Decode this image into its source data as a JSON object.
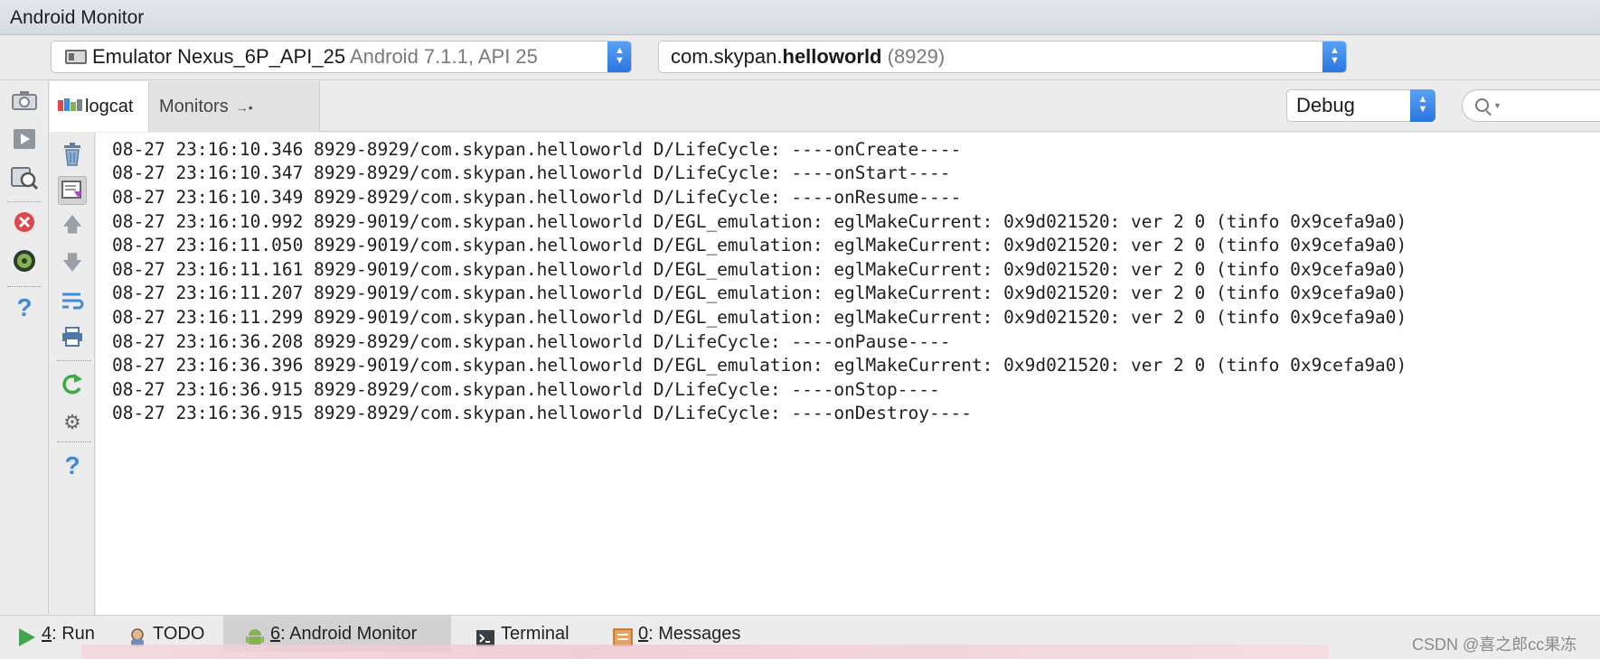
{
  "window": {
    "title": "Android Monitor"
  },
  "device_bar": {
    "device_name": "Emulator Nexus_6P_API_25",
    "device_version": "Android 7.1.1, API 25",
    "process_prefix": "com.skypan.",
    "process_name": "helloworld",
    "process_pid": "(8929)"
  },
  "tabs": {
    "logcat": "logcat",
    "monitors": "Monitors",
    "monitors_pin": "→•"
  },
  "log_level": {
    "selected": "Debug"
  },
  "search": {
    "placeholder": ""
  },
  "log_lines": [
    "08-27 23:16:10.346 8929-8929/com.skypan.helloworld D/LifeCycle: ----onCreate----",
    "08-27 23:16:10.347 8929-8929/com.skypan.helloworld D/LifeCycle: ----onStart----",
    "08-27 23:16:10.349 8929-8929/com.skypan.helloworld D/LifeCycle: ----onResume----",
    "08-27 23:16:10.992 8929-9019/com.skypan.helloworld D/EGL_emulation: eglMakeCurrent: 0x9d021520: ver 2 0 (tinfo 0x9cefa9a0)",
    "08-27 23:16:11.050 8929-9019/com.skypan.helloworld D/EGL_emulation: eglMakeCurrent: 0x9d021520: ver 2 0 (tinfo 0x9cefa9a0)",
    "08-27 23:16:11.161 8929-9019/com.skypan.helloworld D/EGL_emulation: eglMakeCurrent: 0x9d021520: ver 2 0 (tinfo 0x9cefa9a0)",
    "08-27 23:16:11.207 8929-9019/com.skypan.helloworld D/EGL_emulation: eglMakeCurrent: 0x9d021520: ver 2 0 (tinfo 0x9cefa9a0)",
    "08-27 23:16:11.299 8929-9019/com.skypan.helloworld D/EGL_emulation: eglMakeCurrent: 0x9d021520: ver 2 0 (tinfo 0x9cefa9a0)",
    "08-27 23:16:36.208 8929-8929/com.skypan.helloworld D/LifeCycle: ----onPause----",
    "08-27 23:16:36.396 8929-9019/com.skypan.helloworld D/EGL_emulation: eglMakeCurrent: 0x9d021520: ver 2 0 (tinfo 0x9cefa9a0)",
    "08-27 23:16:36.915 8929-8929/com.skypan.helloworld D/LifeCycle: ----onStop----",
    "08-27 23:16:36.915 8929-8929/com.skypan.helloworld D/LifeCycle: ----onDestroy----"
  ],
  "bottom_tabs": {
    "run_key": "4",
    "run_label": ": Run",
    "todo_label": "TODO",
    "android_monitor_key": "6",
    "android_monitor_label": ": Android Monitor",
    "terminal_label": "Terminal",
    "messages_key": "0",
    "messages_label": ": Messages"
  },
  "watermark": "CSDN @喜之郎cc果冻",
  "icons": {
    "outer_toolbar": [
      "camera-icon",
      "screen-record-icon",
      "system-info-icon",
      "terminate-app-icon",
      "layout-inspector-icon",
      "help-icon"
    ],
    "inner_toolbar": [
      "clear-logcat-icon",
      "scroll-to-end-icon",
      "up-stack-trace-icon",
      "down-stack-trace-icon",
      "soft-wraps-icon",
      "print-icon",
      "restart-icon",
      "settings-icon",
      "help-icon"
    ]
  },
  "colors": {
    "accent_blue": "#2a74e0",
    "error_red": "#e0474c",
    "help_blue": "#3d8be0",
    "run_green": "#3fa94a",
    "android_green": "#86b34f"
  }
}
